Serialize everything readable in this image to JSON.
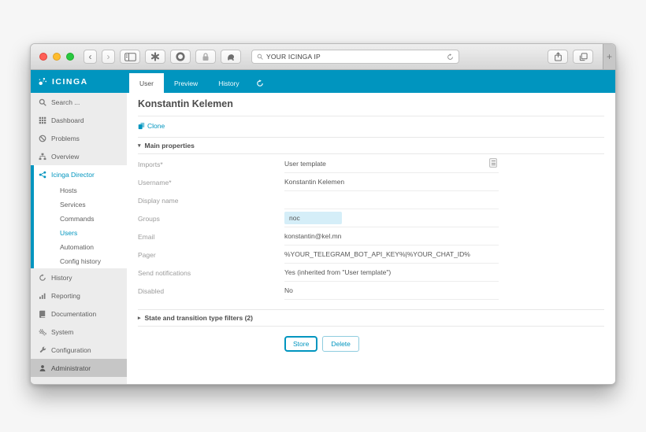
{
  "icons": {
    "back": "‹",
    "forward": "›",
    "new_tab": "+",
    "caret_down": "▾",
    "caret_right": "▸"
  },
  "browser": {
    "url": "YOUR ICINGA IP"
  },
  "logo_text": "ICINGA",
  "sidebar": {
    "items": [
      {
        "label": "Search ...",
        "icon": "search-icon"
      },
      {
        "label": "Dashboard",
        "icon": "dashboard-grid-icon"
      },
      {
        "label": "Problems",
        "icon": "ban-icon"
      },
      {
        "label": "Overview",
        "icon": "sitemap-icon"
      },
      {
        "label": "Icinga Director",
        "icon": "director-nodes-icon"
      },
      {
        "label": "Hosts"
      },
      {
        "label": "Services"
      },
      {
        "label": "Commands"
      },
      {
        "label": "Users"
      },
      {
        "label": "Automation"
      },
      {
        "label": "Config history"
      },
      {
        "label": "History",
        "icon": "history-clock-icon"
      },
      {
        "label": "Reporting",
        "icon": "bar-chart-icon"
      },
      {
        "label": "Documentation",
        "icon": "book-icon"
      },
      {
        "label": "System",
        "icon": "gears-icon"
      },
      {
        "label": "Configuration",
        "icon": "wrench-icon"
      },
      {
        "label": "Administrator",
        "icon": "user-icon"
      }
    ]
  },
  "tabs": [
    {
      "label": "User"
    },
    {
      "label": "Preview"
    },
    {
      "label": "History"
    }
  ],
  "content": {
    "title": "Konstantin Kelemen",
    "clone_label": "Clone",
    "sections": {
      "main": "Main properties",
      "filters": "State and transition type filters (2)"
    },
    "fields": [
      {
        "label": "Imports*",
        "value": "User template"
      },
      {
        "label": "Username*",
        "value": "Konstantin Kelemen"
      },
      {
        "label": "Display name",
        "value": ""
      },
      {
        "label": "Groups",
        "value": "noc"
      },
      {
        "label": "Email",
        "value": "konstantin@kel.mn"
      },
      {
        "label": "Pager",
        "value": "%YOUR_TELEGRAM_BOT_API_KEY%|%YOUR_CHAT_ID%"
      },
      {
        "label": "Send notifications",
        "value": "Yes (inherited from \"User template\")"
      },
      {
        "label": "Disabled",
        "value": "No"
      }
    ],
    "buttons": {
      "store": "Store",
      "delete": "Delete"
    }
  },
  "colors": {
    "accent": "#0095bf",
    "chip_bg": "#d5eef8",
    "sidebar_bg": "#ececec",
    "admin_bg": "#c6c6c6"
  }
}
